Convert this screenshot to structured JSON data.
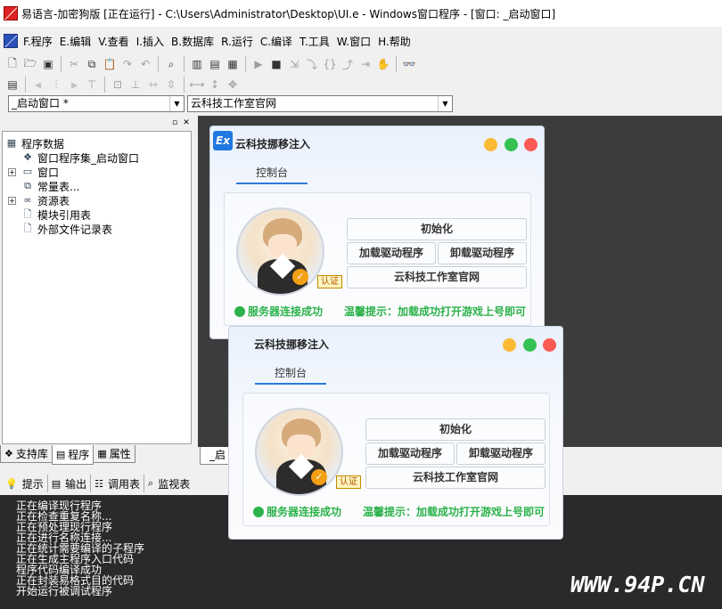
{
  "window": {
    "title": "易语言-加密狗版 [正在运行] - C:\\Users\\Administrator\\Desktop\\UI.e - Windows窗口程序 - [窗口: _启动窗口]"
  },
  "menu": [
    "F.程序",
    "E.编辑",
    "V.查看",
    "I.插入",
    "B.数据库",
    "R.运行",
    "C.编译",
    "T.工具",
    "W.窗口",
    "H.帮助"
  ],
  "combos": {
    "window_select": "_启动窗口 *",
    "element_select": "云科技工作室官网"
  },
  "tree": {
    "root": "程序数据",
    "items": [
      "窗口程序集_启动窗口",
      "窗口",
      "常量表...",
      "资源表",
      "模块引用表",
      "外部文件记录表"
    ]
  },
  "left_tabs": [
    "支持库",
    "程序",
    "属性"
  ],
  "workspace_tab": "_启",
  "bottom_tabs": [
    "提示",
    "输出",
    "调用表",
    "监视表"
  ],
  "console_lines": [
    "正在编译现行程序",
    "正在检查重复名称...",
    "正在预处理现行程序",
    "正在进行名称连接...",
    "正在统计需要编译的子程序",
    "正在生成主程序入口代码",
    "程序代码编译成功",
    "正在封装易格式目的代码",
    "开始运行被调试程序"
  ],
  "injector": {
    "logo": "Ex",
    "title": "云科技挪移注入",
    "tab": "控制台",
    "btn_init": "初始化",
    "btn_load": "加载驱动程序",
    "btn_unload": "卸载驱动程序",
    "btn_site": "云科技工作室官网",
    "cert": "认证",
    "status": "服务器连接成功",
    "tip": "温馨提示：加载成功打开游戏上号即可"
  },
  "watermark": "WWW.94P.CN",
  "colors": {
    "accent_blue": "#2a7ad9",
    "success_green": "#2bb24a",
    "console_bg": "#2a2a2a",
    "workspace_bg": "#3c3c3c"
  }
}
